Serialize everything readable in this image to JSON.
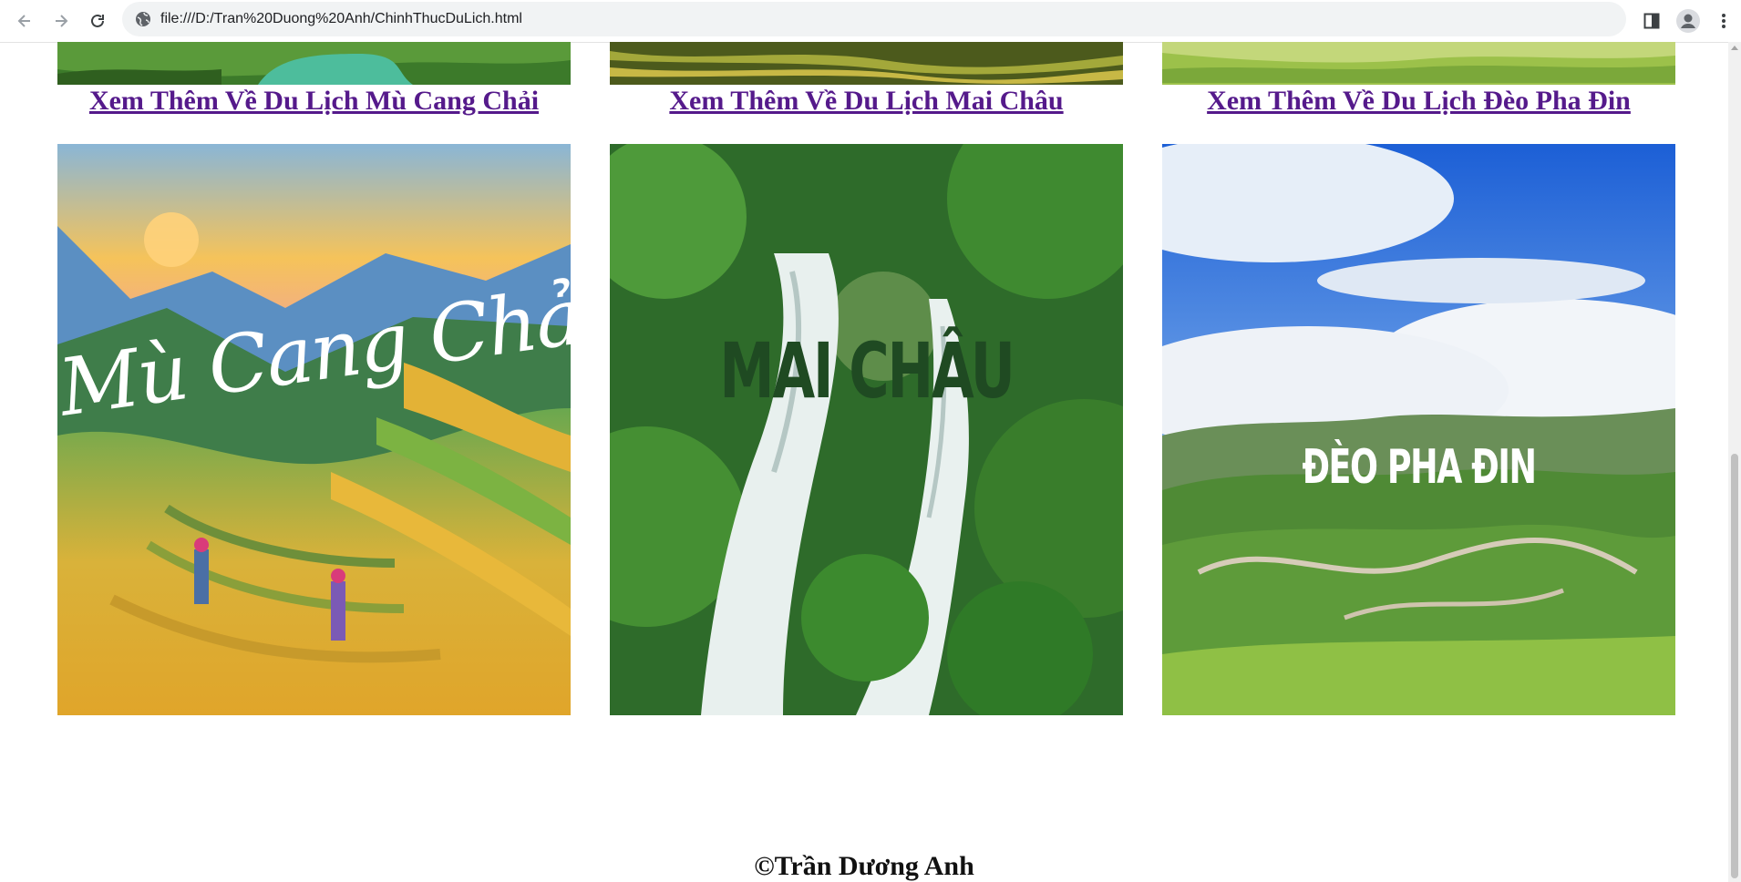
{
  "browser": {
    "url": "file:///D:/Tran%20Duong%20Anh/ChinhThucDuLich.html"
  },
  "destinations": [
    {
      "link_label": "Xem Thêm Về Du Lịch Mù Cang Chải",
      "image_caption": "Mù Cang Chải"
    },
    {
      "link_label": "Xem Thêm Về Du Lịch Mai Châu",
      "image_caption": "MAI CHÂU"
    },
    {
      "link_label": "Xem Thêm Về Du Lịch Đèo Pha Đin",
      "image_caption": "ĐÈO PHA ĐIN"
    }
  ],
  "footer": {
    "copyright": "©Trần Dương Anh"
  },
  "colors": {
    "link": "#551a8b",
    "page_background": "#ffffff"
  }
}
